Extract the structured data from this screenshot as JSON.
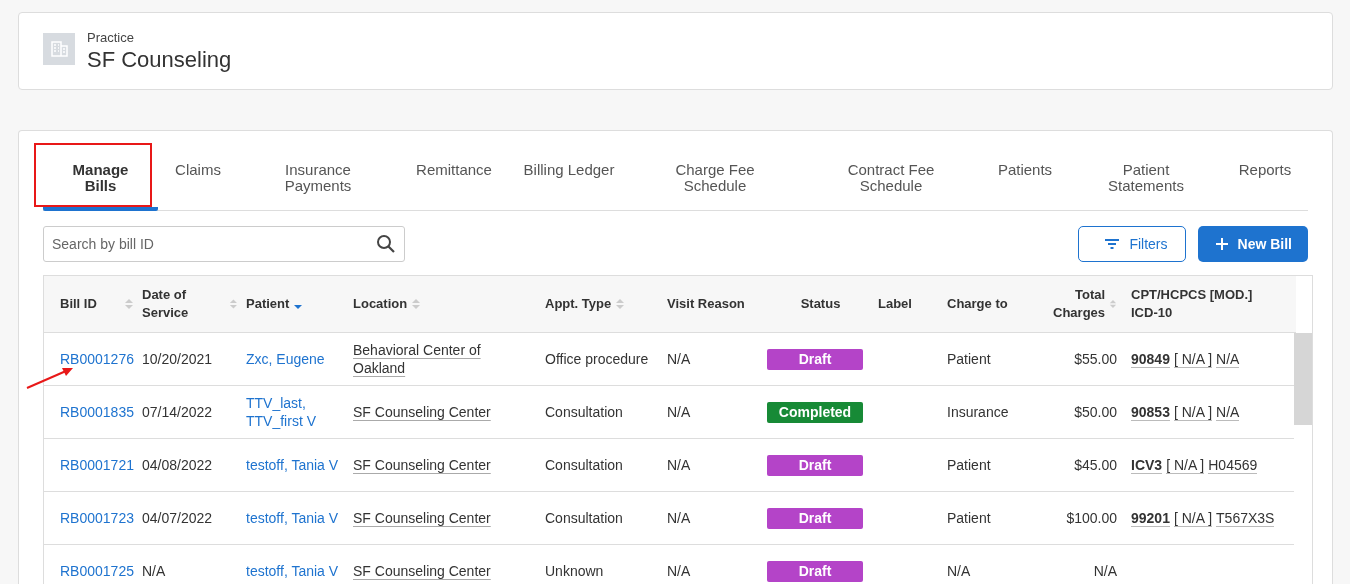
{
  "practice": {
    "label": "Practice",
    "name": "SF Counseling"
  },
  "tabs": [
    {
      "label": "Manage Bills",
      "selected": true
    },
    {
      "label": "Claims",
      "selected": false
    },
    {
      "label": "Insurance Payments",
      "selected": false
    },
    {
      "label": "Remittance",
      "selected": false
    },
    {
      "label": "Billing Ledger",
      "selected": false
    },
    {
      "label": "Charge Fee Schedule",
      "selected": false
    },
    {
      "label": "Contract Fee Schedule",
      "selected": false
    },
    {
      "label": "Patients",
      "selected": false
    },
    {
      "label": "Patient Statements",
      "selected": false
    },
    {
      "label": "Reports",
      "selected": false
    }
  ],
  "search": {
    "placeholder": "Search by bill ID"
  },
  "buttons": [
    {
      "kind": "filters",
      "label": "Filters"
    },
    {
      "kind": "new",
      "label": "New Bill"
    }
  ],
  "table": {
    "columns": [
      {
        "label": "Bill ID",
        "sortable": true,
        "sorted_descending": false
      },
      {
        "label": "Date of Service",
        "sortable": true,
        "sorted_descending": false
      },
      {
        "label": "Patient",
        "sortable": true,
        "sorted_descending": true
      },
      {
        "label": "Location",
        "sortable": true,
        "sorted_descending": false
      },
      {
        "label": "Appt. Type",
        "sortable": true,
        "sorted_descending": false
      },
      {
        "label": "Visit Reason"
      },
      {
        "label": "Status"
      },
      {
        "label": "Label"
      },
      {
        "label": "Charge to"
      },
      {
        "label": "Total Charges",
        "sortable": true,
        "sorted_descending": false
      },
      {
        "label": "CPT/HCPCS [MOD.] ICD-10"
      }
    ],
    "rows": [
      {
        "bill_id": "RB0001276",
        "date": "10/20/2021",
        "patient": "Zxc, Eugene",
        "location": "Behavioral Center of Oakland",
        "appt_type": "Office procedure",
        "visit_reason": "N/A",
        "status": "Draft",
        "color": "#b444c8",
        "charge_to": "Patient",
        "total": "$55.00",
        "cpt": {
          "code": "90849",
          "modifier": "[ N/A ]",
          "icd": "N/A"
        }
      },
      {
        "bill_id": "RB0001835",
        "date": "07/14/2022",
        "patient": "TTV_last, TTV_first V",
        "location": "SF Counseling Center",
        "appt_type": "Consultation",
        "visit_reason": "N/A",
        "status": "Completed",
        "color": "#178a36",
        "charge_to": "Insurance",
        "total": "$50.00",
        "cpt": {
          "code": "90853",
          "modifier": "[ N/A ]",
          "icd": "N/A"
        }
      },
      {
        "bill_id": "RB0001721",
        "date": "04/08/2022",
        "patient": "testoff, Tania V",
        "location": "SF Counseling Center",
        "appt_type": "Consultation",
        "visit_reason": "N/A",
        "status": "Draft",
        "color": "#b444c8",
        "charge_to": "Patient",
        "total": "$45.00",
        "cpt": {
          "code": "ICV3",
          "modifier": "[ N/A ]",
          "icd": "H04569"
        }
      },
      {
        "bill_id": "RB0001723",
        "date": "04/07/2022",
        "patient": "testoff, Tania V",
        "location": "SF Counseling Center",
        "appt_type": "Consultation",
        "visit_reason": "N/A",
        "status": "Draft",
        "color": "#b444c8",
        "charge_to": "Patient",
        "total": "$100.00",
        "cpt": {
          "code": "99201",
          "modifier": "[ N/A ]",
          "icd": "T567X3S"
        }
      },
      {
        "bill_id": "RB0001725",
        "date": "N/A",
        "patient": "testoff, Tania V",
        "location": "SF Counseling Center",
        "appt_type": "Unknown",
        "visit_reason": "N/A",
        "status": "Draft",
        "color": "#b444c8",
        "charge_to": "N/A",
        "total": "N/A"
      }
    ]
  },
  "annotations": {
    "highlight_box": true,
    "arrow": true
  }
}
